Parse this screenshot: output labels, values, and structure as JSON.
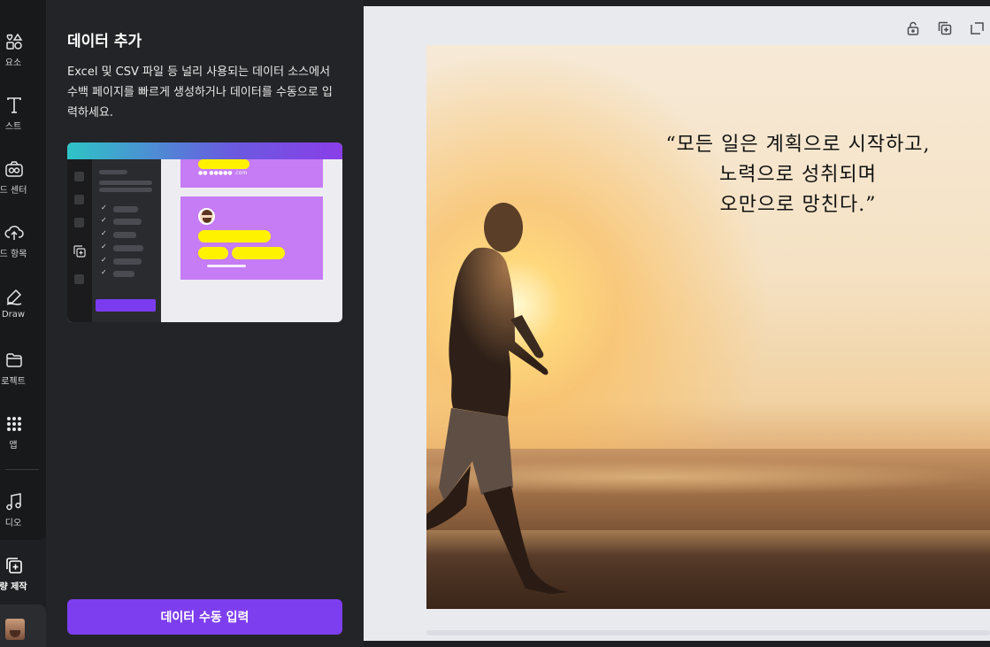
{
  "rail": {
    "items": [
      {
        "label": "요소",
        "icon": "shapes-icon"
      },
      {
        "label": "스트",
        "icon": "text-icon"
      },
      {
        "label": "드 센터",
        "icon": "brand-center-icon"
      },
      {
        "label": "드 항목",
        "icon": "upload-icon"
      },
      {
        "label": "Draw",
        "icon": "draw-icon"
      },
      {
        "label": "로젝트",
        "icon": "folder-icon"
      },
      {
        "label": "앱",
        "icon": "apps-grid-icon"
      },
      {
        "label": "디오",
        "icon": "music-icon"
      },
      {
        "label": "량 제작",
        "icon": "bulk-create-icon"
      }
    ]
  },
  "panel": {
    "title": "데이터 추가",
    "description": "Excel 및 CSV 파일 등 널리 사용되는 데이터 소스에서 수백 페이지를 빠르게 생성하거나 데이터를 수동으로 입력하세요.",
    "button_label": "데이터 수동 입력"
  },
  "illustration": {
    "caption_tiny": "●● ●●●●● .com"
  },
  "canvas": {
    "quote_line1": "“모든 일은 계획으로 시작하고,",
    "quote_line2": "노력으로 성취되며",
    "quote_line3": "오만으로 망친다.”",
    "toolbar": {
      "lock": "lock-icon",
      "duplicate": "duplicate-icon",
      "share": "add-page-icon"
    }
  },
  "colors": {
    "accent": "#7d3ef0",
    "panel_bg": "#232427",
    "canvas_bg": "#e9eaee"
  }
}
